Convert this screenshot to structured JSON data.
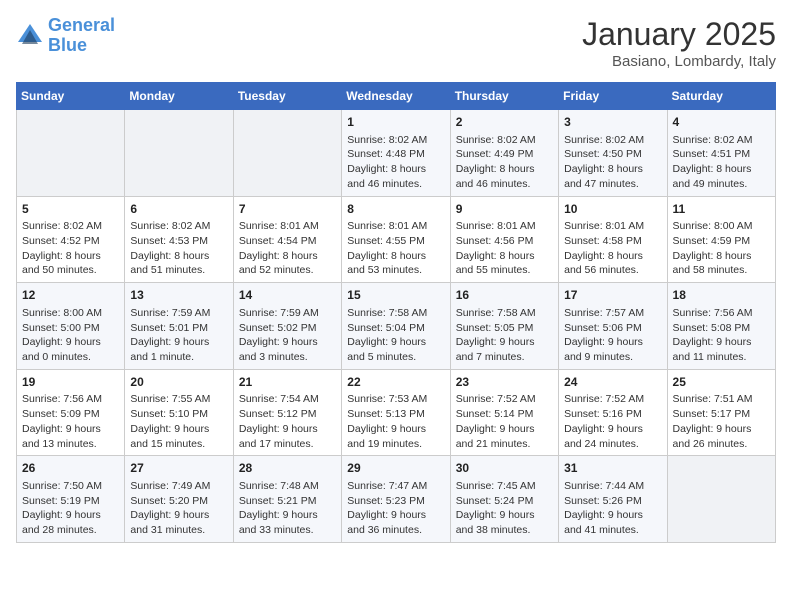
{
  "header": {
    "logo_line1": "General",
    "logo_line2": "Blue",
    "month": "January 2025",
    "location": "Basiano, Lombardy, Italy"
  },
  "weekdays": [
    "Sunday",
    "Monday",
    "Tuesday",
    "Wednesday",
    "Thursday",
    "Friday",
    "Saturday"
  ],
  "weeks": [
    [
      {
        "day": "",
        "content": ""
      },
      {
        "day": "",
        "content": ""
      },
      {
        "day": "",
        "content": ""
      },
      {
        "day": "1",
        "content": "Sunrise: 8:02 AM\nSunset: 4:48 PM\nDaylight: 8 hours\nand 46 minutes."
      },
      {
        "day": "2",
        "content": "Sunrise: 8:02 AM\nSunset: 4:49 PM\nDaylight: 8 hours\nand 46 minutes."
      },
      {
        "day": "3",
        "content": "Sunrise: 8:02 AM\nSunset: 4:50 PM\nDaylight: 8 hours\nand 47 minutes."
      },
      {
        "day": "4",
        "content": "Sunrise: 8:02 AM\nSunset: 4:51 PM\nDaylight: 8 hours\nand 49 minutes."
      }
    ],
    [
      {
        "day": "5",
        "content": "Sunrise: 8:02 AM\nSunset: 4:52 PM\nDaylight: 8 hours\nand 50 minutes."
      },
      {
        "day": "6",
        "content": "Sunrise: 8:02 AM\nSunset: 4:53 PM\nDaylight: 8 hours\nand 51 minutes."
      },
      {
        "day": "7",
        "content": "Sunrise: 8:01 AM\nSunset: 4:54 PM\nDaylight: 8 hours\nand 52 minutes."
      },
      {
        "day": "8",
        "content": "Sunrise: 8:01 AM\nSunset: 4:55 PM\nDaylight: 8 hours\nand 53 minutes."
      },
      {
        "day": "9",
        "content": "Sunrise: 8:01 AM\nSunset: 4:56 PM\nDaylight: 8 hours\nand 55 minutes."
      },
      {
        "day": "10",
        "content": "Sunrise: 8:01 AM\nSunset: 4:58 PM\nDaylight: 8 hours\nand 56 minutes."
      },
      {
        "day": "11",
        "content": "Sunrise: 8:00 AM\nSunset: 4:59 PM\nDaylight: 8 hours\nand 58 minutes."
      }
    ],
    [
      {
        "day": "12",
        "content": "Sunrise: 8:00 AM\nSunset: 5:00 PM\nDaylight: 9 hours\nand 0 minutes."
      },
      {
        "day": "13",
        "content": "Sunrise: 7:59 AM\nSunset: 5:01 PM\nDaylight: 9 hours\nand 1 minute."
      },
      {
        "day": "14",
        "content": "Sunrise: 7:59 AM\nSunset: 5:02 PM\nDaylight: 9 hours\nand 3 minutes."
      },
      {
        "day": "15",
        "content": "Sunrise: 7:58 AM\nSunset: 5:04 PM\nDaylight: 9 hours\nand 5 minutes."
      },
      {
        "day": "16",
        "content": "Sunrise: 7:58 AM\nSunset: 5:05 PM\nDaylight: 9 hours\nand 7 minutes."
      },
      {
        "day": "17",
        "content": "Sunrise: 7:57 AM\nSunset: 5:06 PM\nDaylight: 9 hours\nand 9 minutes."
      },
      {
        "day": "18",
        "content": "Sunrise: 7:56 AM\nSunset: 5:08 PM\nDaylight: 9 hours\nand 11 minutes."
      }
    ],
    [
      {
        "day": "19",
        "content": "Sunrise: 7:56 AM\nSunset: 5:09 PM\nDaylight: 9 hours\nand 13 minutes."
      },
      {
        "day": "20",
        "content": "Sunrise: 7:55 AM\nSunset: 5:10 PM\nDaylight: 9 hours\nand 15 minutes."
      },
      {
        "day": "21",
        "content": "Sunrise: 7:54 AM\nSunset: 5:12 PM\nDaylight: 9 hours\nand 17 minutes."
      },
      {
        "day": "22",
        "content": "Sunrise: 7:53 AM\nSunset: 5:13 PM\nDaylight: 9 hours\nand 19 minutes."
      },
      {
        "day": "23",
        "content": "Sunrise: 7:52 AM\nSunset: 5:14 PM\nDaylight: 9 hours\nand 21 minutes."
      },
      {
        "day": "24",
        "content": "Sunrise: 7:52 AM\nSunset: 5:16 PM\nDaylight: 9 hours\nand 24 minutes."
      },
      {
        "day": "25",
        "content": "Sunrise: 7:51 AM\nSunset: 5:17 PM\nDaylight: 9 hours\nand 26 minutes."
      }
    ],
    [
      {
        "day": "26",
        "content": "Sunrise: 7:50 AM\nSunset: 5:19 PM\nDaylight: 9 hours\nand 28 minutes."
      },
      {
        "day": "27",
        "content": "Sunrise: 7:49 AM\nSunset: 5:20 PM\nDaylight: 9 hours\nand 31 minutes."
      },
      {
        "day": "28",
        "content": "Sunrise: 7:48 AM\nSunset: 5:21 PM\nDaylight: 9 hours\nand 33 minutes."
      },
      {
        "day": "29",
        "content": "Sunrise: 7:47 AM\nSunset: 5:23 PM\nDaylight: 9 hours\nand 36 minutes."
      },
      {
        "day": "30",
        "content": "Sunrise: 7:45 AM\nSunset: 5:24 PM\nDaylight: 9 hours\nand 38 minutes."
      },
      {
        "day": "31",
        "content": "Sunrise: 7:44 AM\nSunset: 5:26 PM\nDaylight: 9 hours\nand 41 minutes."
      },
      {
        "day": "",
        "content": ""
      }
    ]
  ]
}
